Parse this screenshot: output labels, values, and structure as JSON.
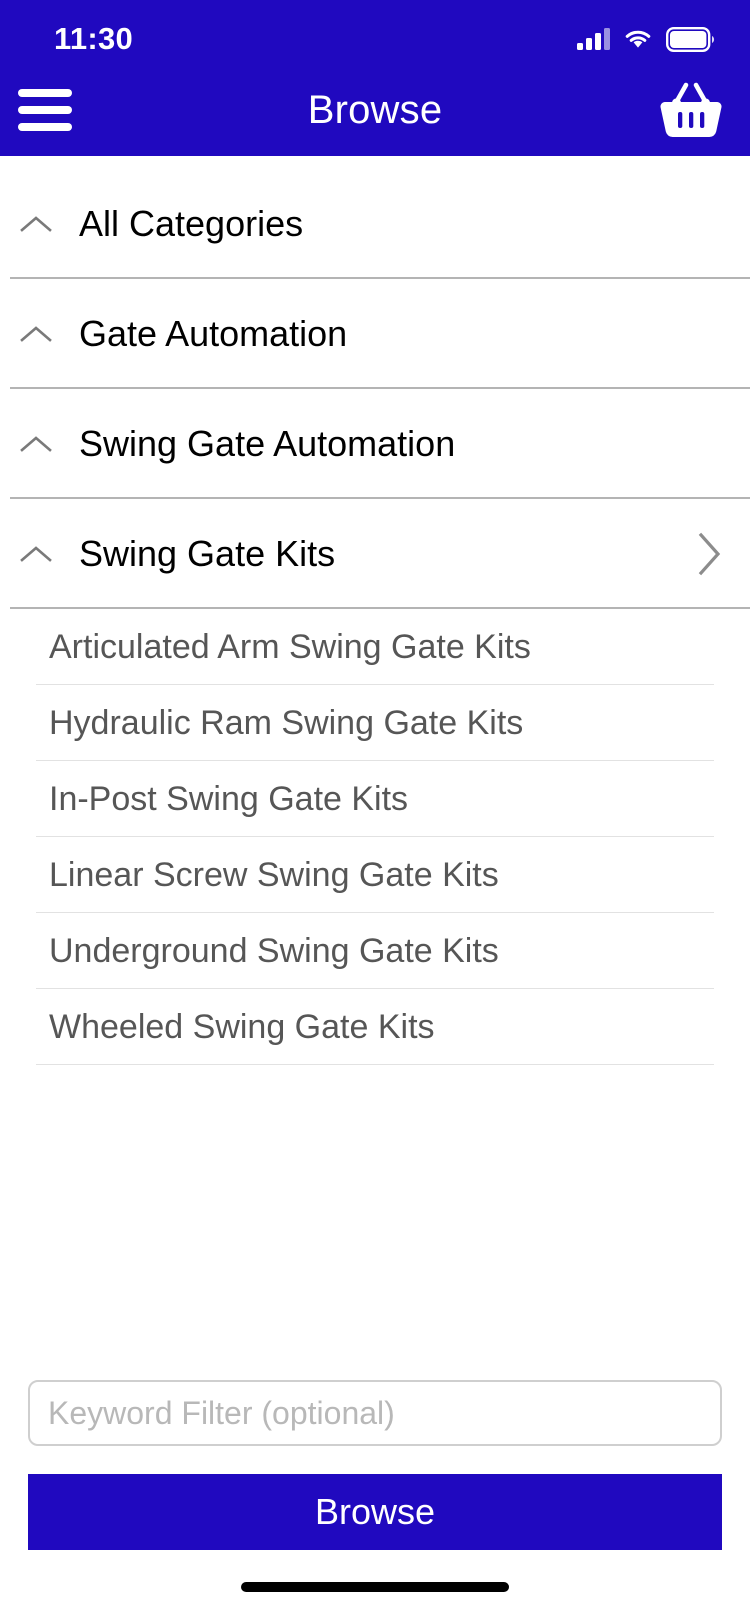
{
  "status_bar": {
    "time": "11:30",
    "signal_icon": "cellular-signal-icon",
    "wifi_icon": "wifi-icon",
    "battery_icon": "battery-icon"
  },
  "header": {
    "title": "Browse",
    "menu_icon": "hamburger-menu-icon",
    "cart_icon": "shopping-basket-icon",
    "background_color": "#2009BF",
    "text_color": "#FFFFFF"
  },
  "breadcrumb_categories": [
    {
      "label": "All Categories",
      "caret_icon": "chevron-up-icon",
      "has_chevron_right": false
    },
    {
      "label": "Gate Automation",
      "caret_icon": "chevron-up-icon",
      "has_chevron_right": false
    },
    {
      "label": "Swing Gate Automation",
      "caret_icon": "chevron-up-icon",
      "has_chevron_right": false
    },
    {
      "label": "Swing Gate Kits",
      "caret_icon": "chevron-up-icon",
      "has_chevron_right": true,
      "chevron_right_icon": "chevron-right-icon"
    }
  ],
  "subcategories": [
    {
      "label": "Articulated Arm Swing Gate Kits"
    },
    {
      "label": "Hydraulic Ram Swing Gate Kits"
    },
    {
      "label": "In-Post Swing Gate Kits"
    },
    {
      "label": "Linear Screw Swing Gate Kits"
    },
    {
      "label": "Underground Swing Gate Kits"
    },
    {
      "label": "Wheeled Swing Gate Kits"
    }
  ],
  "footer": {
    "keyword_filter_placeholder": "Keyword Filter (optional)",
    "keyword_filter_value": "",
    "browse_button_label": "Browse",
    "browse_button_color": "#2009BF"
  }
}
